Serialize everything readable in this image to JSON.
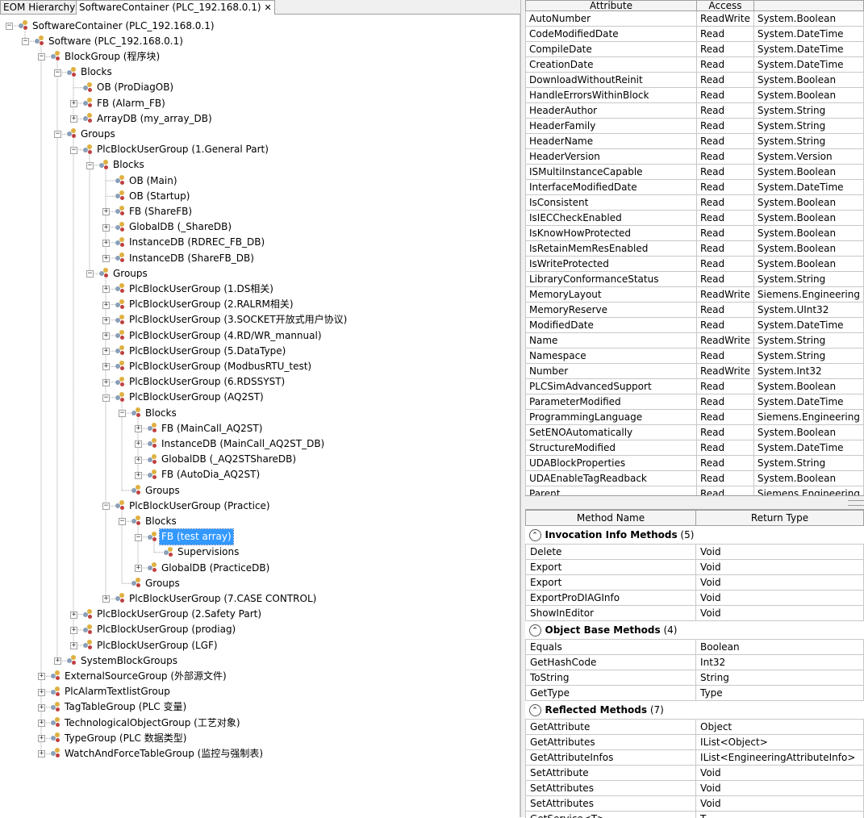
{
  "tabs": [
    {
      "label": "EOM Hierarchy",
      "active": false
    },
    {
      "label": "SoftwareContainer (PLC_192.168.0.1)",
      "active": true,
      "close": "✕"
    }
  ],
  "tree": [
    {
      "text": "SoftwareContainer (PLC_192.168.0.1)",
      "level": 0,
      "toggle": "-"
    },
    {
      "text": "Software (PLC_192.168.0.1)",
      "level": 1,
      "toggle": "-"
    },
    {
      "text": "BlockGroup (程序块)",
      "level": 2,
      "toggle": "-"
    },
    {
      "text": "Blocks",
      "level": 3,
      "toggle": "-"
    },
    {
      "text": "OB (ProDiagOB)",
      "level": 4,
      "toggle": ""
    },
    {
      "text": "FB (Alarm_FB)",
      "level": 4,
      "toggle": "+"
    },
    {
      "text": "ArrayDB (my_array_DB)",
      "level": 4,
      "toggle": "+"
    },
    {
      "text": "Groups",
      "level": 3,
      "toggle": "-"
    },
    {
      "text": "PlcBlockUserGroup (1.General Part)",
      "level": 4,
      "toggle": "-"
    },
    {
      "text": "Blocks",
      "level": 5,
      "toggle": "-"
    },
    {
      "text": "OB (Main)",
      "level": 6,
      "toggle": ""
    },
    {
      "text": "OB (Startup)",
      "level": 6,
      "toggle": ""
    },
    {
      "text": "FB (ShareFB)",
      "level": 6,
      "toggle": "+"
    },
    {
      "text": "GlobalDB (_ShareDB)",
      "level": 6,
      "toggle": "+"
    },
    {
      "text": "InstanceDB (RDREC_FB_DB)",
      "level": 6,
      "toggle": "+"
    },
    {
      "text": "InstanceDB (ShareFB_DB)",
      "level": 6,
      "toggle": "+"
    },
    {
      "text": "Groups",
      "level": 5,
      "toggle": "-"
    },
    {
      "text": "PlcBlockUserGroup (1.DS相关)",
      "level": 6,
      "toggle": "+"
    },
    {
      "text": "PlcBlockUserGroup (2.RALRM相关)",
      "level": 6,
      "toggle": "+"
    },
    {
      "text": "PlcBlockUserGroup (3.SOCKET开放式用户协议)",
      "level": 6,
      "toggle": "+"
    },
    {
      "text": "PlcBlockUserGroup (4.RD/WR_mannual)",
      "level": 6,
      "toggle": "+"
    },
    {
      "text": "PlcBlockUserGroup (5.DataType)",
      "level": 6,
      "toggle": "+"
    },
    {
      "text": "PlcBlockUserGroup (ModbusRTU_test)",
      "level": 6,
      "toggle": "+"
    },
    {
      "text": "PlcBlockUserGroup (6.RDSSYST)",
      "level": 6,
      "toggle": "+"
    },
    {
      "text": "PlcBlockUserGroup (AQ2ST)",
      "level": 6,
      "toggle": "-"
    },
    {
      "text": "Blocks",
      "level": 7,
      "toggle": "-"
    },
    {
      "text": "FB (MainCall_AQ2ST)",
      "level": 8,
      "toggle": "+"
    },
    {
      "text": "InstanceDB (MainCall_AQ2ST_DB)",
      "level": 8,
      "toggle": "+"
    },
    {
      "text": "GlobalDB (_AQ2STShareDB)",
      "level": 8,
      "toggle": "+"
    },
    {
      "text": "FB (AutoDia_AQ2ST)",
      "level": 8,
      "toggle": "+"
    },
    {
      "text": "Groups",
      "level": 7,
      "toggle": ""
    },
    {
      "text": "PlcBlockUserGroup (Practice)",
      "level": 6,
      "toggle": "-"
    },
    {
      "text": "Blocks",
      "level": 7,
      "toggle": "-"
    },
    {
      "text": "FB (test array)",
      "level": 8,
      "toggle": "-",
      "selected": true
    },
    {
      "text": "Supervisions",
      "level": 9,
      "toggle": ""
    },
    {
      "text": "GlobalDB (PracticeDB)",
      "level": 8,
      "toggle": "+"
    },
    {
      "text": "Groups",
      "level": 7,
      "toggle": ""
    },
    {
      "text": "PlcBlockUserGroup (7.CASE CONTROL)",
      "level": 6,
      "toggle": "+"
    },
    {
      "text": "PlcBlockUserGroup (2.Safety Part)",
      "level": 4,
      "toggle": "+"
    },
    {
      "text": "PlcBlockUserGroup (prodiag)",
      "level": 4,
      "toggle": "+"
    },
    {
      "text": "PlcBlockUserGroup (LGF)",
      "level": 4,
      "toggle": "+"
    },
    {
      "text": "SystemBlockGroups",
      "level": 3,
      "toggle": "+"
    },
    {
      "text": "ExternalSourceGroup (外部源文件)",
      "level": 2,
      "toggle": "+"
    },
    {
      "text": "PlcAlarmTextlistGroup",
      "level": 2,
      "toggle": "+"
    },
    {
      "text": "TagTableGroup (PLC 变量)",
      "level": 2,
      "toggle": "+"
    },
    {
      "text": "TechnologicalObjectGroup (工艺对象)",
      "level": 2,
      "toggle": "+"
    },
    {
      "text": "TypeGroup (PLC 数据类型)",
      "level": 2,
      "toggle": "+"
    },
    {
      "text": "WatchAndForceTableGroup (监控与强制表)",
      "level": 2,
      "toggle": "+"
    }
  ],
  "attributes": {
    "headers": [
      "Attribute",
      "Access",
      ""
    ],
    "rows": [
      [
        "AutoNumber",
        "ReadWrite",
        "System.Boolean"
      ],
      [
        "CodeModifiedDate",
        "Read",
        "System.DateTime"
      ],
      [
        "CompileDate",
        "Read",
        "System.DateTime"
      ],
      [
        "CreationDate",
        "Read",
        "System.DateTime"
      ],
      [
        "DownloadWithoutReinit",
        "Read",
        "System.Boolean"
      ],
      [
        "HandleErrorsWithinBlock",
        "Read",
        "System.Boolean"
      ],
      [
        "HeaderAuthor",
        "Read",
        "System.String"
      ],
      [
        "HeaderFamily",
        "Read",
        "System.String"
      ],
      [
        "HeaderName",
        "Read",
        "System.String"
      ],
      [
        "HeaderVersion",
        "Read",
        "System.Version"
      ],
      [
        "ISMultiInstanceCapable",
        "Read",
        "System.Boolean"
      ],
      [
        "InterfaceModifiedDate",
        "Read",
        "System.DateTime"
      ],
      [
        "IsConsistent",
        "Read",
        "System.Boolean"
      ],
      [
        "IsIECCheckEnabled",
        "Read",
        "System.Boolean"
      ],
      [
        "IsKnowHowProtected",
        "Read",
        "System.Boolean"
      ],
      [
        "IsRetainMemResEnabled",
        "Read",
        "System.Boolean"
      ],
      [
        "IsWriteProtected",
        "Read",
        "System.Boolean"
      ],
      [
        "LibraryConformanceStatus",
        "Read",
        "System.String"
      ],
      [
        "MemoryLayout",
        "ReadWrite",
        "Siemens.Engineering"
      ],
      [
        "MemoryReserve",
        "Read",
        "System.UInt32"
      ],
      [
        "ModifiedDate",
        "Read",
        "System.DateTime"
      ],
      [
        "Name",
        "ReadWrite",
        "System.String"
      ],
      [
        "Namespace",
        "Read",
        "System.String"
      ],
      [
        "Number",
        "ReadWrite",
        "System.Int32"
      ],
      [
        "PLCSimAdvancedSupport",
        "Read",
        "System.Boolean"
      ],
      [
        "ParameterModified",
        "Read",
        "System.DateTime"
      ],
      [
        "ProgrammingLanguage",
        "Read",
        "Siemens.Engineering"
      ],
      [
        "SetENOAutomatically",
        "Read",
        "System.Boolean"
      ],
      [
        "StructureModified",
        "Read",
        "System.DateTime"
      ],
      [
        "UDABlockProperties",
        "Read",
        "System.String"
      ],
      [
        "UDAEnableTagReadback",
        "Read",
        "System.Boolean"
      ],
      [
        "Parent",
        "Read",
        "Siemens.Engineering"
      ]
    ]
  },
  "methods": {
    "headers": [
      "Method Name",
      "Return Type"
    ],
    "groups": [
      {
        "title": "Invocation Info Methods",
        "count": "(5)",
        "caret": "⌃",
        "rows": [
          [
            "Delete",
            "Void"
          ],
          [
            "Export",
            "Void"
          ],
          [
            "Export",
            "Void"
          ],
          [
            "ExportProDIAGInfo",
            "Void"
          ],
          [
            "ShowInEditor",
            "Void"
          ]
        ]
      },
      {
        "title": "Object Base Methods",
        "count": "(4)",
        "caret": "⌃",
        "rows": [
          [
            "Equals",
            "Boolean"
          ],
          [
            "GetHashCode",
            "Int32"
          ],
          [
            "ToString",
            "String"
          ],
          [
            "GetType",
            "Type"
          ]
        ]
      },
      {
        "title": "Reflected Methods",
        "count": "(7)",
        "caret": "⌃",
        "rows": [
          [
            "GetAttribute",
            "Object"
          ],
          [
            "GetAttributes",
            "IList<Object>"
          ],
          [
            "GetAttributeInfos",
            "IList<EngineeringAttributeInfo>"
          ],
          [
            "SetAttribute",
            "Void"
          ],
          [
            "SetAttributes",
            "Void"
          ],
          [
            "SetAttributes",
            "Void"
          ],
          [
            "GetService<T>",
            "T"
          ]
        ]
      }
    ]
  }
}
